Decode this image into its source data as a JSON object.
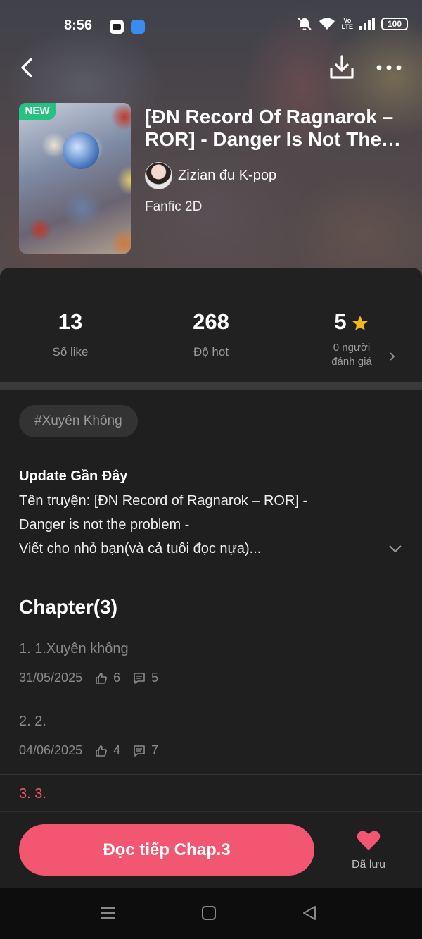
{
  "status_bar": {
    "time": "8:56",
    "network": "VoLTE",
    "battery": "100"
  },
  "story": {
    "badge": "NEW",
    "title": "[ĐN Record Of Ragnarok – ROR] - Danger Is Not The Problem",
    "author": "Zizian đu K-pop",
    "category": "Fanfic 2D"
  },
  "stats": {
    "likes_value": "13",
    "likes_label": "Số like",
    "hot_value": "268",
    "hot_label": "Độ hot",
    "rating_value": "5",
    "rating_label": "0 người đánh giá"
  },
  "tags": [
    "#Xuyên Không"
  ],
  "update": {
    "title": "Update Gần Đây",
    "lines": [
      "Tên truyện: [ĐN Record of Ragnarok – ROR] -",
      "Danger is not the problem -",
      "Viết cho nhỏ bạn(và cả tuôi đọc nựa)..."
    ]
  },
  "chapters": {
    "heading": "Chapter(3)",
    "items": [
      {
        "title": "1. 1.Xuyên không",
        "date": "31/05/2025",
        "likes": "6",
        "comments": "5",
        "current": false
      },
      {
        "title": "2. 2.",
        "date": "04/06/2025",
        "likes": "4",
        "comments": "7",
        "current": false
      },
      {
        "title": "3. 3.",
        "current": true
      }
    ]
  },
  "actions": {
    "read_button": "Đọc tiếp Chap.3",
    "saved_label": "Đã lưu"
  },
  "colors": {
    "accent": "#f25671",
    "new_badge": "#26c281",
    "star": "#f5b81c"
  }
}
